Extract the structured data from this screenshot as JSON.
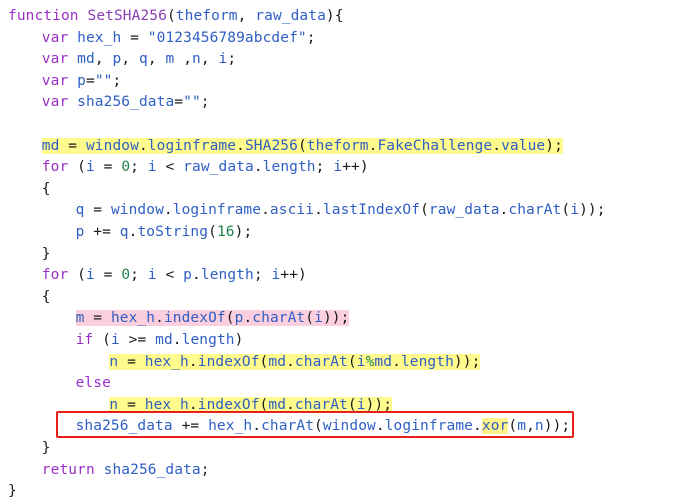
{
  "editor": {
    "language": "JavaScript",
    "background_color": "#ffffff",
    "colors": {
      "keyword": "#9B30C8",
      "identifier": "#2F5FC4",
      "number": "#1E8449",
      "string": "#2F5FC4",
      "punctuation": "#1A1A1A",
      "highlight_yellow": "#FFFB8C",
      "highlight_pink": "#FBCFDD",
      "annotation_box": "#E8201A"
    }
  },
  "annotation": {
    "box_label": "red-rectangle-around-sha256-data-line",
    "box_color": "#E8201A"
  },
  "code": {
    "lines": [
      {
        "id": "line-1",
        "indent": 0,
        "highlight": "none",
        "tokens": [
          {
            "t": "function",
            "c": "kw"
          },
          {
            "t": " ",
            "c": "plain"
          },
          {
            "t": "SetSHA256",
            "c": "fn"
          },
          {
            "t": "(",
            "c": "op"
          },
          {
            "t": "theform",
            "c": "id"
          },
          {
            "t": ", ",
            "c": "op"
          },
          {
            "t": "raw_data",
            "c": "id"
          },
          {
            "t": "){",
            "c": "op"
          }
        ]
      },
      {
        "id": "line-2",
        "indent": 1,
        "highlight": "none",
        "tokens": [
          {
            "t": "var",
            "c": "kw"
          },
          {
            "t": " ",
            "c": "plain"
          },
          {
            "t": "hex_h",
            "c": "id"
          },
          {
            "t": " = ",
            "c": "op"
          },
          {
            "t": "\"0123456789abcdef\"",
            "c": "str"
          },
          {
            "t": ";",
            "c": "op"
          }
        ]
      },
      {
        "id": "line-3",
        "indent": 1,
        "highlight": "none",
        "tokens": [
          {
            "t": "var",
            "c": "kw"
          },
          {
            "t": " ",
            "c": "plain"
          },
          {
            "t": "md",
            "c": "id"
          },
          {
            "t": ", ",
            "c": "op"
          },
          {
            "t": "p",
            "c": "id"
          },
          {
            "t": ", ",
            "c": "op"
          },
          {
            "t": "q",
            "c": "id"
          },
          {
            "t": ", ",
            "c": "op"
          },
          {
            "t": "m",
            "c": "id"
          },
          {
            "t": " ,",
            "c": "op"
          },
          {
            "t": "n",
            "c": "id"
          },
          {
            "t": ", ",
            "c": "op"
          },
          {
            "t": "i",
            "c": "id"
          },
          {
            "t": ";",
            "c": "op"
          }
        ]
      },
      {
        "id": "line-4",
        "indent": 1,
        "highlight": "none",
        "tokens": [
          {
            "t": "var",
            "c": "kw"
          },
          {
            "t": " ",
            "c": "plain"
          },
          {
            "t": "p",
            "c": "id"
          },
          {
            "t": "=",
            "c": "op"
          },
          {
            "t": "\"\"",
            "c": "str"
          },
          {
            "t": ";",
            "c": "op"
          }
        ]
      },
      {
        "id": "line-5",
        "indent": 1,
        "highlight": "none",
        "tokens": [
          {
            "t": "var",
            "c": "kw"
          },
          {
            "t": " ",
            "c": "plain"
          },
          {
            "t": "sha256_data",
            "c": "id"
          },
          {
            "t": "=",
            "c": "op"
          },
          {
            "t": "\"\"",
            "c": "str"
          },
          {
            "t": ";",
            "c": "op"
          }
        ]
      },
      {
        "id": "line-6",
        "indent": 0,
        "highlight": "none",
        "tokens": []
      },
      {
        "id": "line-7",
        "indent": 1,
        "highlight": "yellow",
        "tokens": [
          {
            "t": "md",
            "c": "id"
          },
          {
            "t": " = ",
            "c": "op"
          },
          {
            "t": "window",
            "c": "id"
          },
          {
            "t": ".",
            "c": "op"
          },
          {
            "t": "loginframe",
            "c": "id"
          },
          {
            "t": ".",
            "c": "op"
          },
          {
            "t": "SHA256",
            "c": "id"
          },
          {
            "t": "(",
            "c": "op"
          },
          {
            "t": "theform",
            "c": "id"
          },
          {
            "t": ".",
            "c": "op"
          },
          {
            "t": "FakeChallenge",
            "c": "id"
          },
          {
            "t": ".",
            "c": "op"
          },
          {
            "t": "value",
            "c": "id"
          },
          {
            "t": ");",
            "c": "op"
          }
        ]
      },
      {
        "id": "line-8",
        "indent": 1,
        "highlight": "none",
        "tokens": [
          {
            "t": "for",
            "c": "kw"
          },
          {
            "t": " (",
            "c": "op"
          },
          {
            "t": "i",
            "c": "id"
          },
          {
            "t": " = ",
            "c": "op"
          },
          {
            "t": "0",
            "c": "num"
          },
          {
            "t": "; ",
            "c": "op"
          },
          {
            "t": "i",
            "c": "id"
          },
          {
            "t": " < ",
            "c": "op"
          },
          {
            "t": "raw_data",
            "c": "id"
          },
          {
            "t": ".",
            "c": "op"
          },
          {
            "t": "length",
            "c": "id"
          },
          {
            "t": "; ",
            "c": "op"
          },
          {
            "t": "i",
            "c": "id"
          },
          {
            "t": "++)",
            "c": "op"
          }
        ]
      },
      {
        "id": "line-9",
        "indent": 1,
        "highlight": "none",
        "tokens": [
          {
            "t": "{",
            "c": "op"
          }
        ]
      },
      {
        "id": "line-10",
        "indent": 2,
        "highlight": "none",
        "tokens": [
          {
            "t": "q",
            "c": "id"
          },
          {
            "t": " = ",
            "c": "op"
          },
          {
            "t": "window",
            "c": "id"
          },
          {
            "t": ".",
            "c": "op"
          },
          {
            "t": "loginframe",
            "c": "id"
          },
          {
            "t": ".",
            "c": "op"
          },
          {
            "t": "ascii",
            "c": "id"
          },
          {
            "t": ".",
            "c": "op"
          },
          {
            "t": "lastIndexOf",
            "c": "id"
          },
          {
            "t": "(",
            "c": "op"
          },
          {
            "t": "raw_data",
            "c": "id"
          },
          {
            "t": ".",
            "c": "op"
          },
          {
            "t": "charAt",
            "c": "id"
          },
          {
            "t": "(",
            "c": "op"
          },
          {
            "t": "i",
            "c": "id"
          },
          {
            "t": "));",
            "c": "op"
          }
        ]
      },
      {
        "id": "line-11",
        "indent": 2,
        "highlight": "none",
        "tokens": [
          {
            "t": "p",
            "c": "id"
          },
          {
            "t": " += ",
            "c": "op"
          },
          {
            "t": "q",
            "c": "id"
          },
          {
            "t": ".",
            "c": "op"
          },
          {
            "t": "toString",
            "c": "id"
          },
          {
            "t": "(",
            "c": "op"
          },
          {
            "t": "16",
            "c": "num"
          },
          {
            "t": ");",
            "c": "op"
          }
        ]
      },
      {
        "id": "line-12",
        "indent": 1,
        "highlight": "none",
        "tokens": [
          {
            "t": "}",
            "c": "op"
          }
        ]
      },
      {
        "id": "line-13",
        "indent": 1,
        "highlight": "none",
        "tokens": [
          {
            "t": "for",
            "c": "kw"
          },
          {
            "t": " (",
            "c": "op"
          },
          {
            "t": "i",
            "c": "id"
          },
          {
            "t": " = ",
            "c": "op"
          },
          {
            "t": "0",
            "c": "num"
          },
          {
            "t": "; ",
            "c": "op"
          },
          {
            "t": "i",
            "c": "id"
          },
          {
            "t": " < ",
            "c": "op"
          },
          {
            "t": "p",
            "c": "id"
          },
          {
            "t": ".",
            "c": "op"
          },
          {
            "t": "length",
            "c": "id"
          },
          {
            "t": "; ",
            "c": "op"
          },
          {
            "t": "i",
            "c": "id"
          },
          {
            "t": "++)",
            "c": "op"
          }
        ]
      },
      {
        "id": "line-14",
        "indent": 1,
        "highlight": "none",
        "tokens": [
          {
            "t": "{",
            "c": "op"
          }
        ]
      },
      {
        "id": "line-15",
        "indent": 2,
        "highlight": "pink",
        "tokens": [
          {
            "t": "m",
            "c": "id"
          },
          {
            "t": " = ",
            "c": "op"
          },
          {
            "t": "hex_h",
            "c": "id"
          },
          {
            "t": ".",
            "c": "op"
          },
          {
            "t": "indexOf",
            "c": "id"
          },
          {
            "t": "(",
            "c": "op"
          },
          {
            "t": "p",
            "c": "id"
          },
          {
            "t": ".",
            "c": "op"
          },
          {
            "t": "charAt",
            "c": "id"
          },
          {
            "t": "(",
            "c": "op"
          },
          {
            "t": "i",
            "c": "id"
          },
          {
            "t": "));",
            "c": "op"
          }
        ]
      },
      {
        "id": "line-16",
        "indent": 2,
        "highlight": "none",
        "tokens": [
          {
            "t": "if",
            "c": "kw"
          },
          {
            "t": " (",
            "c": "op"
          },
          {
            "t": "i",
            "c": "id"
          },
          {
            "t": " >= ",
            "c": "op"
          },
          {
            "t": "md",
            "c": "id"
          },
          {
            "t": ".",
            "c": "op"
          },
          {
            "t": "length",
            "c": "id"
          },
          {
            "t": ")",
            "c": "op"
          }
        ]
      },
      {
        "id": "line-17",
        "indent": 3,
        "highlight": "yellow",
        "tokens": [
          {
            "t": "n",
            "c": "id"
          },
          {
            "t": " = ",
            "c": "op"
          },
          {
            "t": "hex_h",
            "c": "id"
          },
          {
            "t": ".",
            "c": "op"
          },
          {
            "t": "indexOf",
            "c": "id"
          },
          {
            "t": "(",
            "c": "op"
          },
          {
            "t": "md",
            "c": "id"
          },
          {
            "t": ".",
            "c": "op"
          },
          {
            "t": "charAt",
            "c": "id"
          },
          {
            "t": "(",
            "c": "op"
          },
          {
            "t": "i",
            "c": "id"
          },
          {
            "t": "%",
            "c": "pct"
          },
          {
            "t": "md",
            "c": "id"
          },
          {
            "t": ".",
            "c": "op"
          },
          {
            "t": "length",
            "c": "id"
          },
          {
            "t": "));",
            "c": "op"
          }
        ]
      },
      {
        "id": "line-18",
        "indent": 2,
        "highlight": "none",
        "tokens": [
          {
            "t": "else",
            "c": "kw"
          }
        ]
      },
      {
        "id": "line-19",
        "indent": 3,
        "highlight": "yellow",
        "tokens": [
          {
            "t": "n",
            "c": "id"
          },
          {
            "t": " = ",
            "c": "op"
          },
          {
            "t": "hex_h",
            "c": "id"
          },
          {
            "t": ".",
            "c": "op"
          },
          {
            "t": "indexOf",
            "c": "id"
          },
          {
            "t": "(",
            "c": "op"
          },
          {
            "t": "md",
            "c": "id"
          },
          {
            "t": ".",
            "c": "op"
          },
          {
            "t": "charAt",
            "c": "id"
          },
          {
            "t": "(",
            "c": "op"
          },
          {
            "t": "i",
            "c": "id"
          },
          {
            "t": "));",
            "c": "op"
          }
        ]
      },
      {
        "id": "line-20",
        "indent": 2,
        "highlight": "none",
        "boxed": true,
        "tokens": [
          {
            "t": "sha256_data",
            "c": "id"
          },
          {
            "t": " += ",
            "c": "op"
          },
          {
            "t": "hex_h",
            "c": "id"
          },
          {
            "t": ".",
            "c": "op"
          },
          {
            "t": "charAt",
            "c": "id"
          },
          {
            "t": "(",
            "c": "op"
          },
          {
            "t": "window",
            "c": "id"
          },
          {
            "t": ".",
            "c": "op"
          },
          {
            "t": "loginframe",
            "c": "id"
          },
          {
            "t": ".",
            "c": "op"
          },
          {
            "t": "xor",
            "c": "id",
            "hl": "yellow"
          },
          {
            "t": "(",
            "c": "op"
          },
          {
            "t": "m",
            "c": "id"
          },
          {
            "t": ",",
            "c": "op"
          },
          {
            "t": "n",
            "c": "id"
          },
          {
            "t": "));",
            "c": "op"
          }
        ]
      },
      {
        "id": "line-21",
        "indent": 1,
        "highlight": "none",
        "tokens": [
          {
            "t": "}",
            "c": "op"
          }
        ]
      },
      {
        "id": "line-22",
        "indent": 1,
        "highlight": "none",
        "tokens": [
          {
            "t": "return",
            "c": "kw"
          },
          {
            "t": " ",
            "c": "plain"
          },
          {
            "t": "sha256_data",
            "c": "id"
          },
          {
            "t": ";",
            "c": "op"
          }
        ]
      },
      {
        "id": "line-23",
        "indent": 0,
        "highlight": "none",
        "tokens": [
          {
            "t": "}",
            "c": "op"
          }
        ]
      }
    ]
  }
}
